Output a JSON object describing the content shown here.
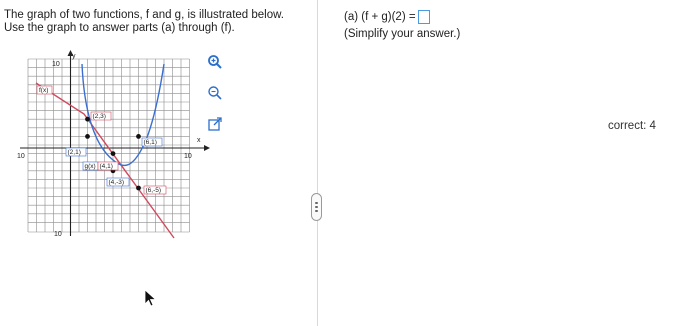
{
  "prompt": {
    "line1": "The graph of two functions, f and g, is illustrated below.",
    "line2": "Use the graph to answer parts (a) through (f)."
  },
  "graph": {
    "axis": {
      "x_label": "x",
      "y_label": "y",
      "x_min_label": "10",
      "x_max_label": "10",
      "y_max_label": "10",
      "y_min_label": "10"
    },
    "f_label": "f(x)",
    "g_label": "g(x)",
    "points": [
      {
        "label": "(2,3)"
      },
      {
        "label": "(2,1)"
      },
      {
        "label": "(4,1)"
      },
      {
        "label": "(4,-3)"
      },
      {
        "label": "(6,1)"
      },
      {
        "label": "(6,-5)"
      }
    ]
  },
  "question": {
    "part_a_text": "(a) (f + g)(2) =",
    "answer_value": "",
    "hint": "(Simplify your answer.)"
  },
  "status": {
    "text": "correct: 4"
  },
  "colors": {
    "f_curve": "#d04b5f",
    "g_curve": "#3a6fd1",
    "accent": "#4b9be0"
  }
}
